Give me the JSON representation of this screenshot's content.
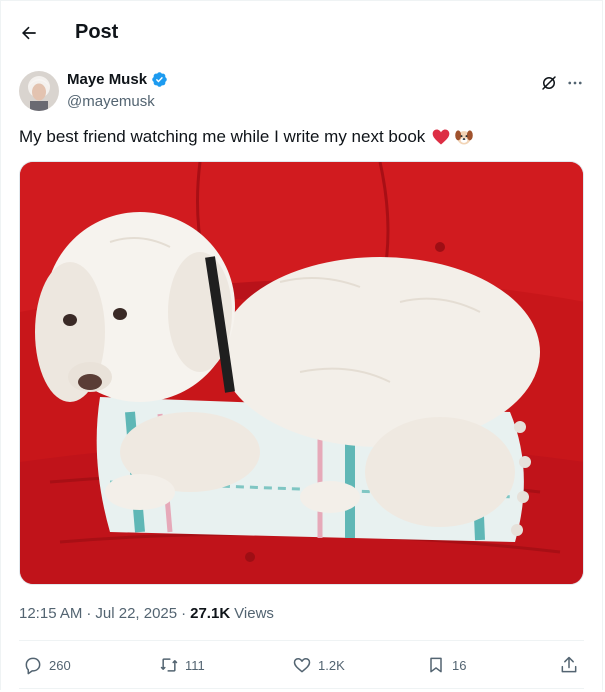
{
  "header": {
    "title": "Post"
  },
  "author": {
    "display_name": "Maye Musk",
    "handle": "@mayemusk",
    "verified": true
  },
  "tweet": {
    "text": "My best friend watching me while I write my next book",
    "emojis": [
      "red-heart",
      "dog-face"
    ]
  },
  "meta": {
    "time": "12:15 AM",
    "date": "Jul 22, 2025",
    "views_count": "27.1K",
    "views_label": "Views",
    "separator": "·"
  },
  "actions": {
    "replies": "260",
    "reposts": "111",
    "likes": "1.2K",
    "bookmarks": "16"
  },
  "colors": {
    "verified": "#1d9bf0",
    "muted": "#536471",
    "couch": "#c8161a",
    "dog": "#f3efe9",
    "pillow": "#5fb7b6"
  }
}
